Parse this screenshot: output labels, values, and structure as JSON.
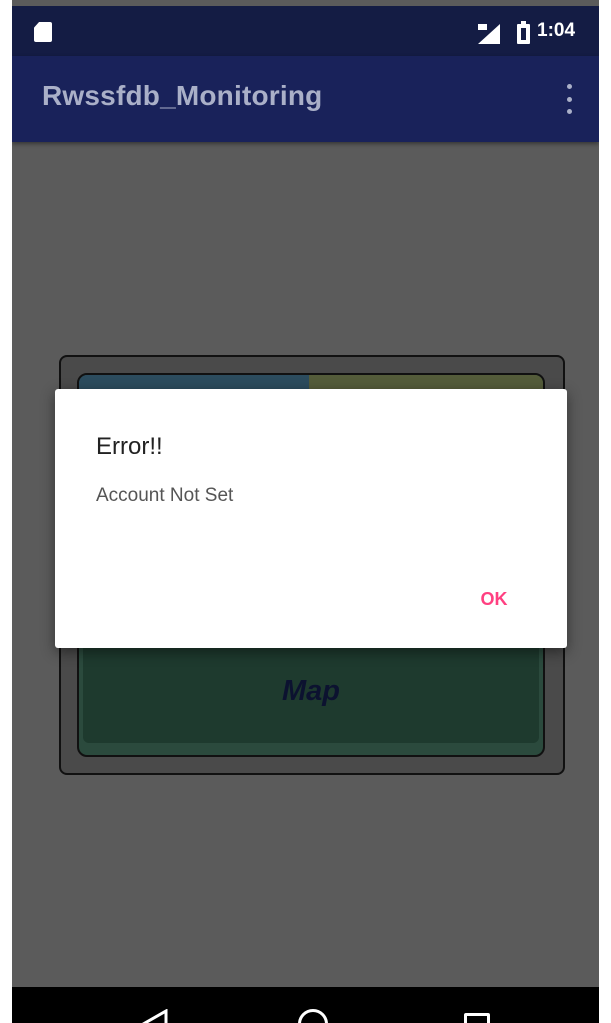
{
  "status_bar": {
    "time": "1:04",
    "icons": [
      "sd-card-icon",
      "signal-icon",
      "battery-icon"
    ]
  },
  "app_bar": {
    "title": "Rwssfdb_Monitoring",
    "menu_icon": "overflow-menu-icon"
  },
  "background_card": {
    "map_button_label": "Map"
  },
  "dialog": {
    "title": "Error!!",
    "message": "Account Not Set",
    "ok_label": "OK",
    "accent_color": "#ff4081"
  },
  "nav_bar": {
    "icons": [
      "back-icon",
      "home-icon",
      "recents-icon"
    ]
  },
  "colors": {
    "status_bar": "#141c44",
    "app_bar": "#19225a",
    "scrim_background": "#5b5b5b"
  }
}
